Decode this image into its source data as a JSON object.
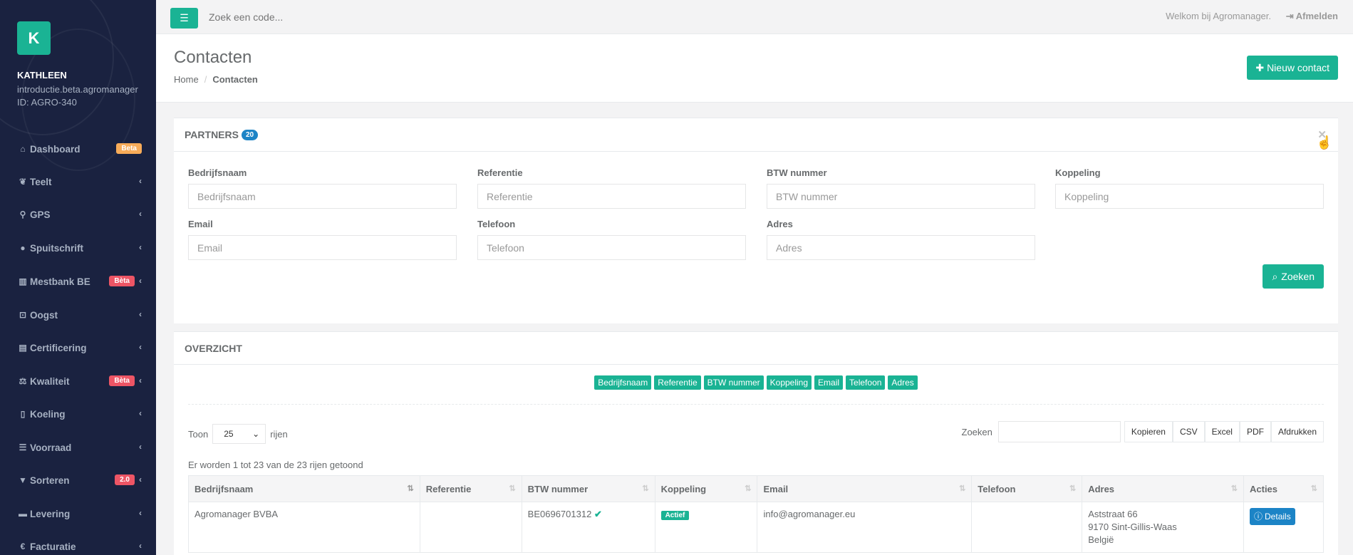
{
  "sidebar": {
    "logo_letter": "K",
    "user_name": "KATHLEEN",
    "domain": "introductie.beta.agromanager",
    "id": "ID: AGRO-340",
    "items": [
      {
        "label": "Dashboard",
        "icon": "home-icon",
        "glyph": "⌂",
        "badge": "Beta"
      },
      {
        "label": "Teelt",
        "icon": "leaf-icon",
        "glyph": "❦"
      },
      {
        "label": "GPS",
        "icon": "map-marker-icon",
        "glyph": "⚲"
      },
      {
        "label": "Spuitschrift",
        "icon": "tint-icon",
        "glyph": "●"
      },
      {
        "label": "Mestbank BE",
        "icon": "bank-icon",
        "glyph": "▥",
        "badge": "Bèta"
      },
      {
        "label": "Oogst",
        "icon": "basket-icon",
        "glyph": "⊡"
      },
      {
        "label": "Certificering",
        "icon": "book-icon",
        "glyph": "▤"
      },
      {
        "label": "Kwaliteit",
        "icon": "balance-scale-icon",
        "glyph": "⚖",
        "badge": "Bèta"
      },
      {
        "label": "Koeling",
        "icon": "thermometer-icon",
        "glyph": "▯"
      },
      {
        "label": "Voorraad",
        "icon": "list-icon",
        "glyph": "☰"
      },
      {
        "label": "Sorteren",
        "icon": "filter-icon",
        "glyph": "▼",
        "badge": "2.0"
      },
      {
        "label": "Levering",
        "icon": "truck-icon",
        "glyph": "▬"
      },
      {
        "label": "Facturatie",
        "icon": "euro-icon",
        "glyph": "€"
      }
    ]
  },
  "topbar": {
    "search_placeholder": "Zoek een code...",
    "welcome": "Welkom bij Agromanager.",
    "logout": "Afmelden"
  },
  "heading": {
    "title": "Contacten",
    "breadcrumb_home": "Home",
    "breadcrumb_current": "Contacten",
    "new_button": "Nieuw contact"
  },
  "partners": {
    "title": "PARTNERS",
    "count": "20",
    "fields": [
      {
        "label": "Bedrijfsnaam",
        "placeholder": "Bedrijfsnaam"
      },
      {
        "label": "Referentie",
        "placeholder": "Referentie"
      },
      {
        "label": "BTW nummer",
        "placeholder": "BTW nummer"
      },
      {
        "label": "Koppeling",
        "placeholder": "Koppeling"
      },
      {
        "label": "Email",
        "placeholder": "Email"
      },
      {
        "label": "Telefoon",
        "placeholder": "Telefoon"
      },
      {
        "label": "Adres",
        "placeholder": "Adres"
      }
    ],
    "search_button": "Zoeken"
  },
  "overzicht": {
    "title": "OVERZICHT",
    "column_toggles": [
      "Bedrijfsnaam",
      "Referentie",
      "BTW nummer",
      "Koppeling",
      "Email",
      "Telefoon",
      "Adres"
    ],
    "show_label": "Toon",
    "page_size": "25",
    "rows_label": "rijen",
    "search_label": "Zoeken",
    "export_buttons": [
      "Kopieren",
      "CSV",
      "Excel",
      "PDF",
      "Afdrukken"
    ],
    "info": "Er worden 1 tot 23 van de 23 rijen getoond",
    "columns": [
      "Bedrijfsnaam",
      "Referentie",
      "BTW nummer",
      "Koppeling",
      "Email",
      "Telefoon",
      "Adres",
      "Acties"
    ],
    "rows": [
      {
        "bedrijfsnaam": "Agromanager BVBA",
        "referentie": "",
        "btw": "BE0696701312",
        "koppeling": "Actief",
        "email": "info@agromanager.eu",
        "telefoon": "",
        "adres_1": "Aststraat 66",
        "adres_2": "9170 Sint-Gillis-Waas",
        "adres_3": "België",
        "actie": "Details"
      }
    ]
  },
  "colors": {
    "primary": "#1ab394",
    "info": "#1c84c6",
    "sidebar_bg": "#1a2240",
    "warning": "#f8ac59",
    "danger": "#ed5565"
  }
}
